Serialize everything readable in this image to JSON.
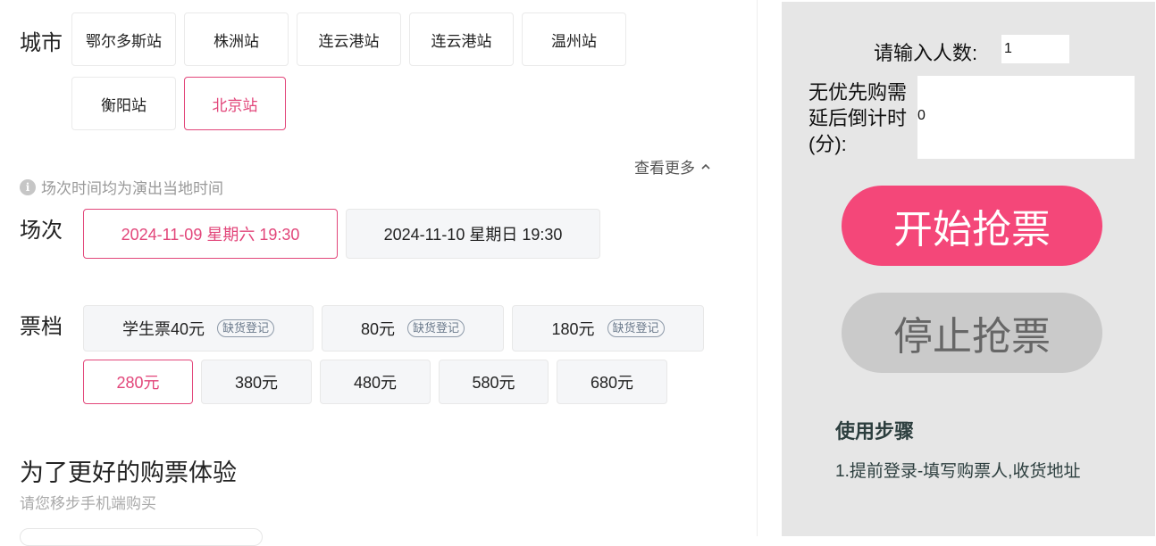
{
  "city": {
    "label": "城市",
    "options": [
      "鄂尔多斯站",
      "株洲站",
      "连云港站",
      "连云港站",
      "温州站",
      "衡阳站",
      "北京站"
    ],
    "selected": "北京站",
    "more_label": "查看更多"
  },
  "hint": "场次时间均为演出当地时间",
  "session": {
    "label": "场次",
    "options": [
      "2024-11-09 星期六 19:30",
      "2024-11-10 星期日 19:30"
    ],
    "selected": "2024-11-09 星期六 19:30"
  },
  "tier": {
    "label": "票档",
    "options": [
      {
        "price": "学生票40元",
        "tag": "缺货登记"
      },
      {
        "price": "80元",
        "tag": "缺货登记"
      },
      {
        "price": "180元",
        "tag": "缺货登记"
      },
      {
        "price": "280元",
        "tag": ""
      },
      {
        "price": "380元",
        "tag": ""
      },
      {
        "price": "480元",
        "tag": ""
      },
      {
        "price": "580元",
        "tag": ""
      },
      {
        "price": "680元",
        "tag": ""
      }
    ],
    "selected": "280元"
  },
  "promo": {
    "title": "为了更好的购票体验",
    "subtitle": "请您移步手机端购买"
  },
  "panel": {
    "people_label": "请输入人数:",
    "people_value": "1",
    "delay_label_lines": [
      "无优先购需",
      "延后倒计时",
      "(分):"
    ],
    "delay_value": "0",
    "start_button": "开始抢票",
    "stop_button": "停止抢票",
    "steps_title": "使用步骤",
    "steps": [
      "1.提前登录-填写购票人,收货地址"
    ]
  },
  "colors": {
    "accent": "#e2467a",
    "start_button": "#f44779",
    "stop_button": "#cacaca",
    "panel_bg": "#e6e6e6"
  }
}
